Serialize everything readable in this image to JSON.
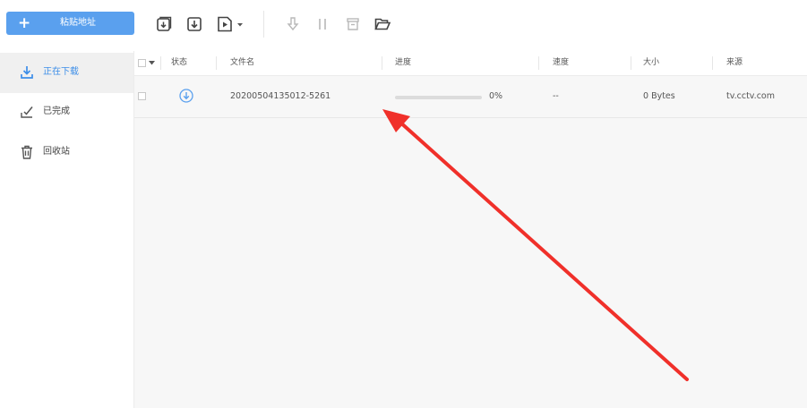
{
  "toolbar": {
    "paste_label": "粘贴地址",
    "icons": [
      "new-task-icon",
      "import-icon",
      "play-dropdown-icon",
      "start-icon",
      "pause-icon",
      "delete-icon",
      "open-folder-icon"
    ]
  },
  "sidebar": {
    "items": [
      {
        "label": "正在下载",
        "icon": "download-icon",
        "active": true
      },
      {
        "label": "已完成",
        "icon": "completed-icon",
        "active": false
      },
      {
        "label": "回收站",
        "icon": "trash-icon",
        "active": false
      }
    ]
  },
  "table": {
    "columns": {
      "status": "状态",
      "filename": "文件名",
      "progress": "进度",
      "speed": "速度",
      "size": "大小",
      "source": "来源"
    },
    "rows": [
      {
        "filename": "20200504135012-5261",
        "progress_text": "0%",
        "progress_fraction": 0,
        "speed": "--",
        "size": "0 Bytes",
        "source": "tv.cctv.com"
      }
    ]
  },
  "colors": {
    "accent": "#5aa0ee",
    "active_text": "#3d8ee8",
    "annotation_arrow": "#f0302a"
  }
}
